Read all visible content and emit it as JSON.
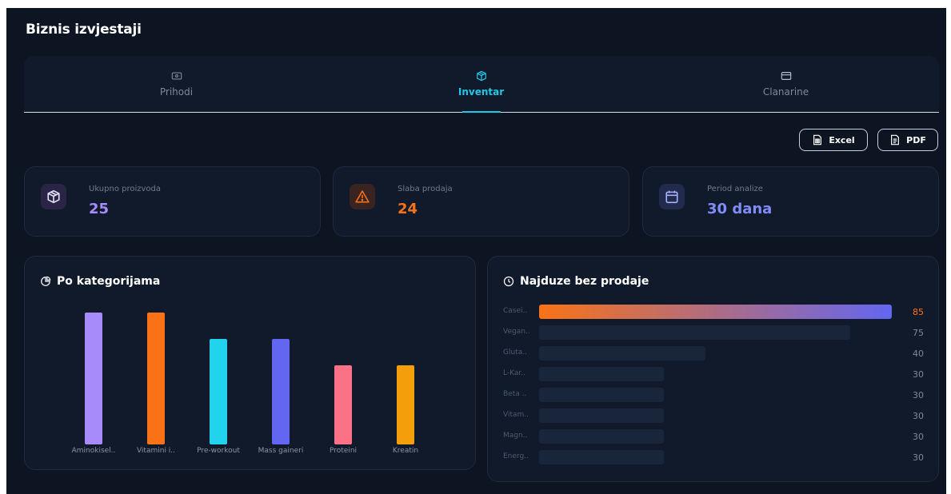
{
  "app": {
    "title": "Biznis izvjestaji"
  },
  "tabs": [
    {
      "label": "Prihodi",
      "icon": "cash-icon",
      "active": false
    },
    {
      "label": "Inventar",
      "icon": "box-icon",
      "active": true
    },
    {
      "label": "Clanarine",
      "icon": "card-icon",
      "active": false
    }
  ],
  "export": {
    "excel_label": "Excel",
    "pdf_label": "PDF"
  },
  "stats": [
    {
      "label": "Ukupno proizvoda",
      "value": "25",
      "icon": "box-icon",
      "color": "#a78bfa",
      "icon_bg": "#2a2547"
    },
    {
      "label": "Slaba prodaja",
      "value": "24",
      "icon": "warning-icon",
      "color": "#f97316",
      "icon_bg": "#3a2421"
    },
    {
      "label": "Period analize",
      "value": "30 dana",
      "icon": "calendar-icon",
      "color": "#818cf8",
      "icon_bg": "#222a4d"
    }
  ],
  "category_panel": {
    "title": "Po kategorijama",
    "icon": "pie-chart-icon"
  },
  "stale_panel": {
    "title": "Najduze bez prodaje",
    "icon": "clock-icon"
  },
  "chart_data": [
    {
      "type": "bar",
      "title": "Po kategorijama",
      "categories": [
        "Aminokisel..",
        "Vitamini i..",
        "Pre-workout",
        "Mass gaineri",
        "Proteini",
        "Kreatin"
      ],
      "values": [
        5,
        5,
        4,
        4,
        3,
        3
      ],
      "ylim": [
        0,
        5
      ],
      "colors": [
        "#a78bfa",
        "#f97316",
        "#22d3ee",
        "#6366f1",
        "#fb7185",
        "#f59e0b"
      ],
      "grid": false
    },
    {
      "type": "bar",
      "orientation": "horizontal",
      "title": "Najduze bez prodaje",
      "categories": [
        "Casei..",
        "Vegan..",
        "Gluta..",
        "L-Kar..",
        "Beta ..",
        "Vitam..",
        "Magn..",
        "Energ.."
      ],
      "values": [
        85,
        75,
        40,
        30,
        30,
        30,
        30,
        30
      ],
      "xlim": [
        0,
        85
      ],
      "highlight_color_start": "#f97316",
      "highlight_color_end": "#6366f1",
      "highlight_value_color": "#f97316",
      "grid": false
    }
  ]
}
